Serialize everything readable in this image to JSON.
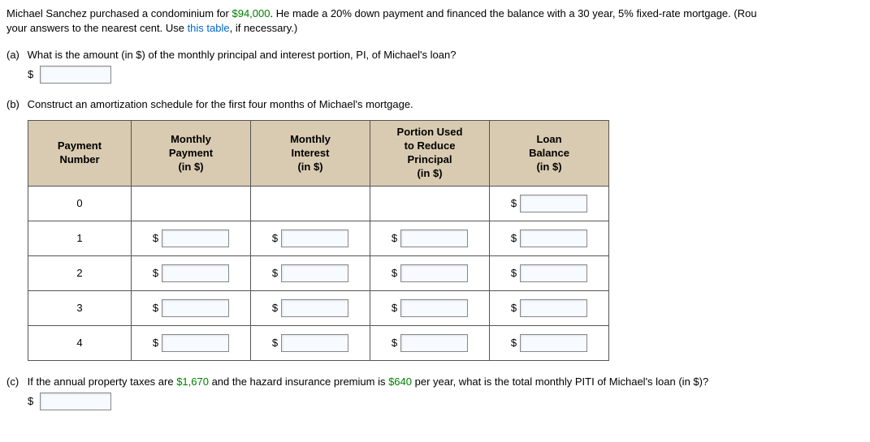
{
  "intro": {
    "text1": "Michael Sanchez purchased a condominium for ",
    "amount": "$94,000",
    "text2": ". He made a 20% down payment and financed the balance with a 30 year, 5% fixed-rate mortgage. (Rou",
    "text3": "your answers to the nearest cent. Use ",
    "link": "this table",
    "text4": ", if necessary.)"
  },
  "partA": {
    "label": "(a)",
    "question": "What is the amount (in $) of the monthly principal and interest portion, PI, of Michael's loan?",
    "dollar": "$"
  },
  "partB": {
    "label": "(b)",
    "question": "Construct an amortization schedule for the first four months of Michael's mortgage.",
    "headers": {
      "col1": "Payment\nNumber",
      "col2": "Monthly\nPayment\n(in $)",
      "col3": "Monthly\nInterest\n(in $)",
      "col4": "Portion Used\nto Reduce\nPrincipal\n(in $)",
      "col5": "Loan\nBalance\n(in $)"
    },
    "rows": [
      "0",
      "1",
      "2",
      "3",
      "4"
    ],
    "dollar": "$"
  },
  "partC": {
    "label": "(c)",
    "text1": "If the annual property taxes are ",
    "amount1": "$1,670",
    "text2": " and the hazard insurance premium is ",
    "amount2": "$640",
    "text3": " per year, what is the total monthly PITI of Michael's loan (in $)?",
    "dollar": "$"
  }
}
